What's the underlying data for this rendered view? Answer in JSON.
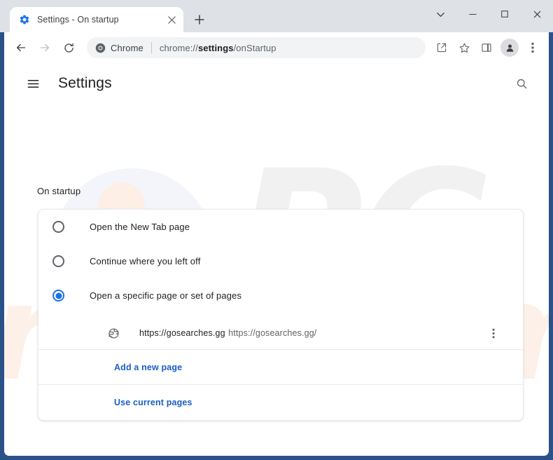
{
  "window": {
    "frame_color": "#2b5288",
    "controls": [
      {
        "name": "tab-search",
        "glyph": "chevron-down"
      },
      {
        "name": "minimize",
        "glyph": "minimize"
      },
      {
        "name": "maximize",
        "glyph": "maximize"
      },
      {
        "name": "close",
        "glyph": "close"
      }
    ]
  },
  "tabstrip": {
    "tabs": [
      {
        "title": "Settings - On startup",
        "favicon": "settings-gear-icon",
        "active": true
      }
    ],
    "new_tab_label": "+"
  },
  "toolbar": {
    "back_icon": "back-arrow-icon",
    "forward_icon": "forward-arrow-icon",
    "reload_icon": "reload-icon",
    "omnibox": {
      "chip_icon": "chrome-logo-icon",
      "chip_label": "Chrome",
      "url_prefix": "chrome://",
      "url_bold": "settings",
      "url_suffix": "/onStartup",
      "full_url": "chrome://settings/onStartup"
    },
    "actions": [
      {
        "name": "share-icon"
      },
      {
        "name": "bookmark-star-icon"
      },
      {
        "name": "side-panel-icon"
      }
    ],
    "avatar_icon": "profile-avatar-icon",
    "menu_icon": "three-dot-menu-icon"
  },
  "settings": {
    "menu_icon": "hamburger-menu-icon",
    "title": "Settings",
    "search_icon": "search-icon"
  },
  "on_startup": {
    "section_title": "On startup",
    "options": [
      {
        "label": "Open the New Tab page",
        "selected": false
      },
      {
        "label": "Continue where you left off",
        "selected": false
      },
      {
        "label": "Open a specific page or set of pages",
        "selected": true
      }
    ],
    "pages": [
      {
        "icon": "globe-icon",
        "title": "https://gosearches.gg",
        "url": "https://gosearches.gg/",
        "more_icon": "three-dot-menu-icon"
      }
    ],
    "links": [
      {
        "label": "Add a new page"
      },
      {
        "label": "Use current pages"
      }
    ],
    "accent_color": "#1a73e8",
    "link_color": "#1a5fc4"
  },
  "watermarks": {
    "top": "PC",
    "bottom": "risk.com"
  }
}
